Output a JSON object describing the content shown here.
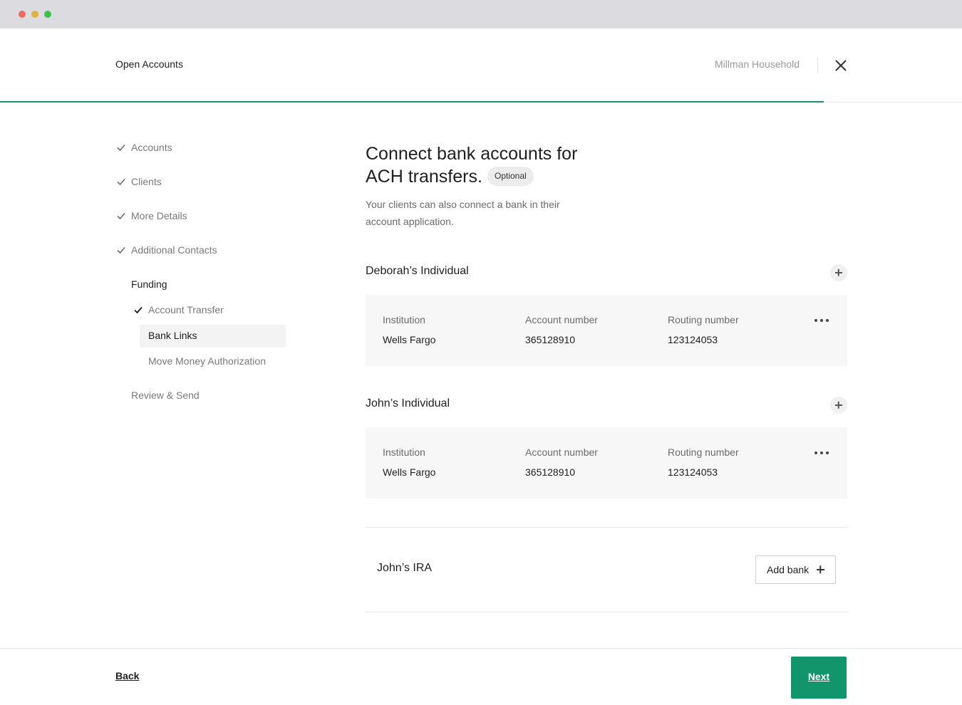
{
  "window": {
    "controls": [
      "close",
      "minimize",
      "zoom"
    ]
  },
  "header": {
    "title": "Open Accounts",
    "household": "Millman Household",
    "close_icon": "close-icon",
    "progress_percent": 85.6,
    "accent_color": "#12956b"
  },
  "steps": [
    {
      "label": "Accounts",
      "status": "done"
    },
    {
      "label": "Clients",
      "status": "done"
    },
    {
      "label": "More Details",
      "status": "done"
    },
    {
      "label": "Additional Contacts",
      "status": "done"
    },
    {
      "label": "Funding",
      "status": "in-progress"
    },
    {
      "label": "Review & Send",
      "status": "pending"
    }
  ],
  "substeps": [
    {
      "label": "Account Transfer",
      "status": "done"
    },
    {
      "label": "Bank Links",
      "status": "current"
    },
    {
      "label": "Move Money Authorization",
      "status": "pending"
    }
  ],
  "main": {
    "title": "Connect bank accounts for ACH transfers.",
    "badge": "Optional",
    "subtitle": "Your clients can also connect a bank in their account application.",
    "column_labels": {
      "institution": "Institution",
      "account_number": "Account number",
      "routing_number": "Routing number"
    },
    "accounts": [
      {
        "name": "Deborah’s Individual",
        "bank": {
          "institution": "Wells Fargo",
          "account_number": "365128910",
          "routing_number": "123124053"
        }
      },
      {
        "name": "John’s Individual",
        "bank": {
          "institution": "Wells Fargo",
          "account_number": "365128910",
          "routing_number": "123124053"
        }
      },
      {
        "name": "John’s IRA",
        "add_bank_label": "Add bank"
      }
    ]
  },
  "footer": {
    "back_label": "Back",
    "next_label": "Next"
  }
}
